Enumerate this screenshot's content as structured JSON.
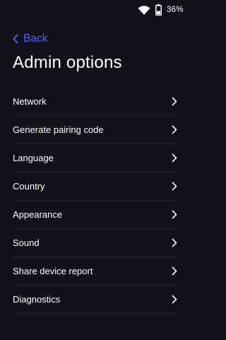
{
  "status_bar": {
    "wifi_icon": "wifi-icon",
    "battery_icon": "battery-icon",
    "battery_percent": "36%"
  },
  "nav": {
    "back_label": "Back",
    "back_icon": "chevron-left-icon",
    "accent_color": "#5560f5"
  },
  "page": {
    "title": "Admin options"
  },
  "menu": {
    "chevron_icon": "chevron-right-icon",
    "items": [
      {
        "label": "Network"
      },
      {
        "label": "Generate pairing code"
      },
      {
        "label": "Language"
      },
      {
        "label": "Country"
      },
      {
        "label": "Appearance"
      },
      {
        "label": "Sound"
      },
      {
        "label": "Share device report"
      },
      {
        "label": "Diagnostics"
      }
    ]
  },
  "colors": {
    "background": "#111119",
    "text": "#ffffff",
    "divider": "#2b2b35"
  }
}
